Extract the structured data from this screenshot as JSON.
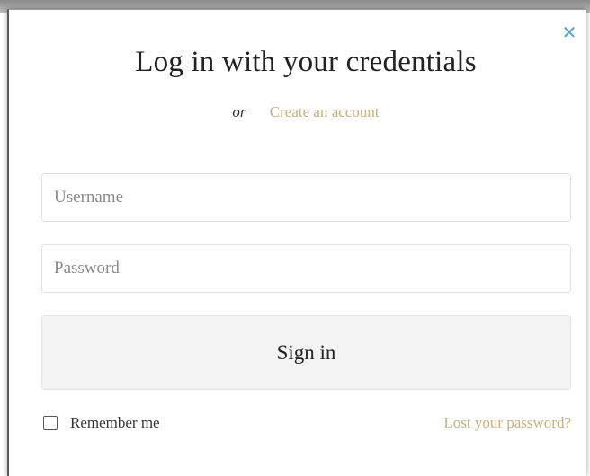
{
  "modal": {
    "title": "Log in with your credentials",
    "close_symbol": "✕",
    "close_icon": "close-icon",
    "or_text": "or",
    "create_account_link": "Create an account",
    "username_placeholder": "Username",
    "username_value": "",
    "password_placeholder": "Password",
    "password_value": "",
    "signin_label": "Sign in",
    "remember_label": "Remember me",
    "remember_checked": false,
    "lost_password_link": "Lost your password?"
  },
  "colors": {
    "accent_link": "#c9b07a",
    "close_icon": "#4aa3df",
    "button_bg": "#f3f3f3"
  }
}
